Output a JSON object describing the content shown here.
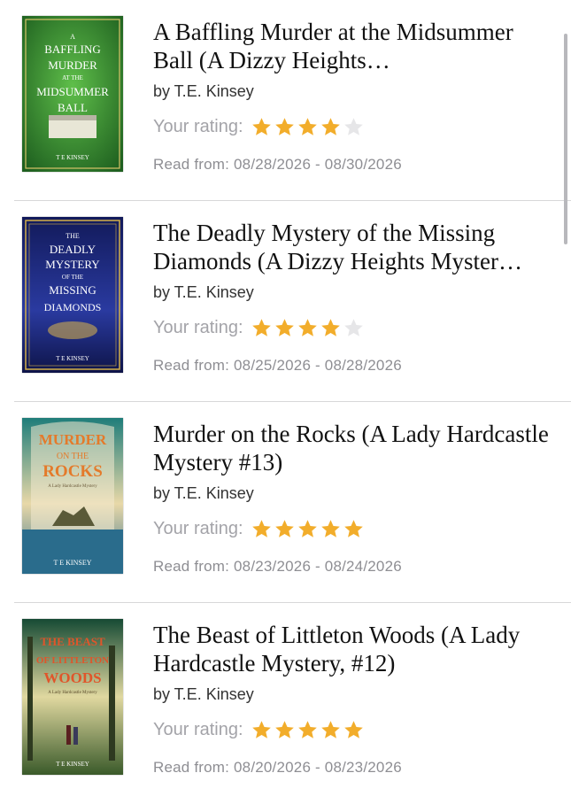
{
  "books": [
    {
      "title": "A Baffling Murder at the Midsummer Ball (A Dizzy Heights…",
      "author": "by T.E. Kinsey",
      "rating_label": "Your rating:",
      "rating": 4,
      "dates": "Read from: 08/28/2026 - 08/30/2026",
      "cover": {
        "lines": [
          "A",
          "BAFFLING",
          "MURDER",
          "AT THE",
          "MIDSUMMER",
          "BALL"
        ],
        "author": "T E KINSEY",
        "bg": "#2f7f2e"
      }
    },
    {
      "title": "The Deadly Mystery of the Missing Diamonds (A Dizzy Heights Myster…",
      "author": "by T.E. Kinsey",
      "rating_label": "Your rating:",
      "rating": 4,
      "dates": "Read from: 08/25/2026 - 08/28/2026",
      "cover": {
        "lines": [
          "THE",
          "DEADLY",
          "MYSTERY",
          "OF THE",
          "MISSING",
          "DIAMONDS"
        ],
        "author": "T E KINSEY",
        "bg": "#1c2470"
      }
    },
    {
      "title": "Murder on the Rocks (A Lady Hardcastle Mystery #13)",
      "author": "by T.E. Kinsey",
      "rating_label": "Your rating:",
      "rating": 5,
      "dates": "Read from: 08/23/2026 - 08/24/2026",
      "cover": {
        "lines": [
          "MURDER",
          "ON THE",
          "ROCKS"
        ],
        "subtitle": "A Lady Hardcastle Mystery",
        "author": "T E KINSEY",
        "bg": "#1f7d7a"
      }
    },
    {
      "title": "The Beast of Littleton Woods (A Lady Hardcastle Mystery, #12)",
      "author": "by T.E. Kinsey",
      "rating_label": "Your rating:",
      "rating": 5,
      "dates": "Read from: 08/20/2026 - 08/23/2026",
      "cover": {
        "lines": [
          "THE BEAST",
          "OF LITTLETON",
          "WOODS"
        ],
        "subtitle": "A Lady Hardcastle Mystery",
        "author": "T E KINSEY",
        "bg": "#1c5a3c"
      }
    }
  ],
  "colors": {
    "star_filled": "#f2ad2b",
    "star_empty": "#e6e6e8"
  }
}
